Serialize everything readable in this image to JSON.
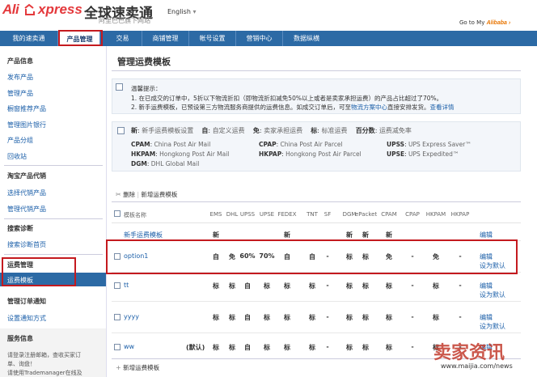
{
  "header": {
    "logo_brand": "Ali",
    "logo_express": "xpress",
    "logo_cn": "全球速卖通",
    "logo_sub": "阿里巴巴旗下网站",
    "language": "English",
    "goto_label": "Go to My",
    "goto_brand": "Alibaba"
  },
  "nav": {
    "items": [
      "我的速卖通",
      "产品管理",
      "交易",
      "商铺管理",
      "帐号设置",
      "营销中心",
      "数据纵横"
    ]
  },
  "sidebar": {
    "sections": [
      {
        "title": "产品信息",
        "items": [
          "发布产品",
          "管理产品",
          "橱窗推荐产品",
          "管理图片银行",
          "产品分组",
          "回收站"
        ]
      },
      {
        "title": "淘宝产品代销",
        "items": [
          "选择代销产品",
          "管理代销产品"
        ]
      },
      {
        "title": "搜索诊断",
        "items": [
          "搜索诊断首页"
        ]
      },
      {
        "title": "运费管理",
        "items": [
          "运费模板"
        ]
      },
      {
        "title": "管理订单通知",
        "items": [
          "设置通知方式"
        ]
      },
      {
        "title": "服务信息",
        "items": []
      }
    ],
    "info_text": [
      "请登录注册邮箱，查收买家订",
      "单、询盘！",
      "请使用Trademanager在线及"
    ]
  },
  "main": {
    "title": "管理运费模板",
    "notice": {
      "label": "温馨提示：",
      "line1": "1. 在已成交的订单中，5折以下物流折扣（即物流折扣减免50%以上或者是卖家承担运费）的产品占比超过了70%。",
      "line2a": "2. 新手运费模板，已预设第三方物流服务商提供的运费信息。如成交订单后，可至",
      "line2_link": "物流方案中心",
      "line2b": "直接安排发货。",
      "line2_more": "查看详情"
    },
    "legend": {
      "r1": [
        {
          "k": "新",
          "v": "新手运费模板设置"
        },
        {
          "k": "自",
          "v": "自定义运费"
        },
        {
          "k": "免",
          "v": "卖家承担运费"
        },
        {
          "k": "标",
          "v": "标准运费"
        },
        {
          "k": "百分数",
          "v": "运费减免率"
        }
      ],
      "r2": [
        {
          "k": "CPAM",
          "v": "China Post Air Mail"
        },
        {
          "k": "CPAP",
          "v": "China Post Air Parcel"
        },
        {
          "k": "UPSS",
          "v": "UPS Express Saver™"
        }
      ],
      "r3": [
        {
          "k": "HKPAM",
          "v": "Hongkong Post Air Mail"
        },
        {
          "k": "HKPAP",
          "v": "Hongkong Post Air Parcel"
        },
        {
          "k": "UPSE",
          "v": "UPS Expedited™"
        }
      ],
      "r4": [
        {
          "k": "DGM",
          "v": "DHL Global Mail"
        }
      ]
    },
    "toolbar": {
      "delete": "删除",
      "new": "新增运费模板"
    },
    "table": {
      "name_header": "模板名称",
      "columns": [
        "EMS",
        "DHL",
        "UPSS",
        "UPSE",
        "FEDEX",
        "TNT",
        "SF",
        "DGM",
        "ePacket",
        "CPAM",
        "CPAP",
        "HKPAM",
        "HKPAP"
      ],
      "rows": [
        {
          "name": "新手运费模板",
          "checkbox": false,
          "prefix": "",
          "cells": [
            "新",
            "",
            "",
            "",
            "新",
            "",
            "",
            "新",
            "新",
            "新",
            "",
            "",
            ""
          ],
          "actions": [
            "编辑"
          ]
        },
        {
          "name": "option1",
          "checkbox": true,
          "prefix": "",
          "cells": [
            "自",
            "免",
            "60%",
            "70%",
            "自",
            "自",
            "-",
            "标",
            "标",
            "免",
            "-",
            "免",
            "-"
          ],
          "actions": [
            "编辑",
            "设为默认"
          ]
        },
        {
          "name": "tt",
          "checkbox": true,
          "prefix": "",
          "cells": [
            "标",
            "标",
            "自",
            "标",
            "标",
            "标",
            "-",
            "标",
            "标",
            "标",
            "-",
            "标",
            "-"
          ],
          "actions": [
            "编辑",
            "设为默认"
          ]
        },
        {
          "name": "yyyy",
          "checkbox": true,
          "prefix": "",
          "cells": [
            "标",
            "标",
            "自",
            "标",
            "标",
            "标",
            "-",
            "标",
            "标",
            "标",
            "-",
            "标",
            "-"
          ],
          "actions": [
            "编辑",
            "设为默认"
          ]
        },
        {
          "name": "ww",
          "checkbox": true,
          "prefix": "(默认)",
          "cells": [
            "标",
            "标",
            "自",
            "标",
            "标",
            "标",
            "-",
            "标",
            "标",
            "标",
            "-",
            "标",
            "-"
          ],
          "actions": [
            "编辑"
          ]
        }
      ]
    },
    "bottom": {
      "new": "新增运费模板"
    }
  },
  "watermark": {
    "brand": "卖家资讯",
    "url": "www.maijia.com/news"
  }
}
